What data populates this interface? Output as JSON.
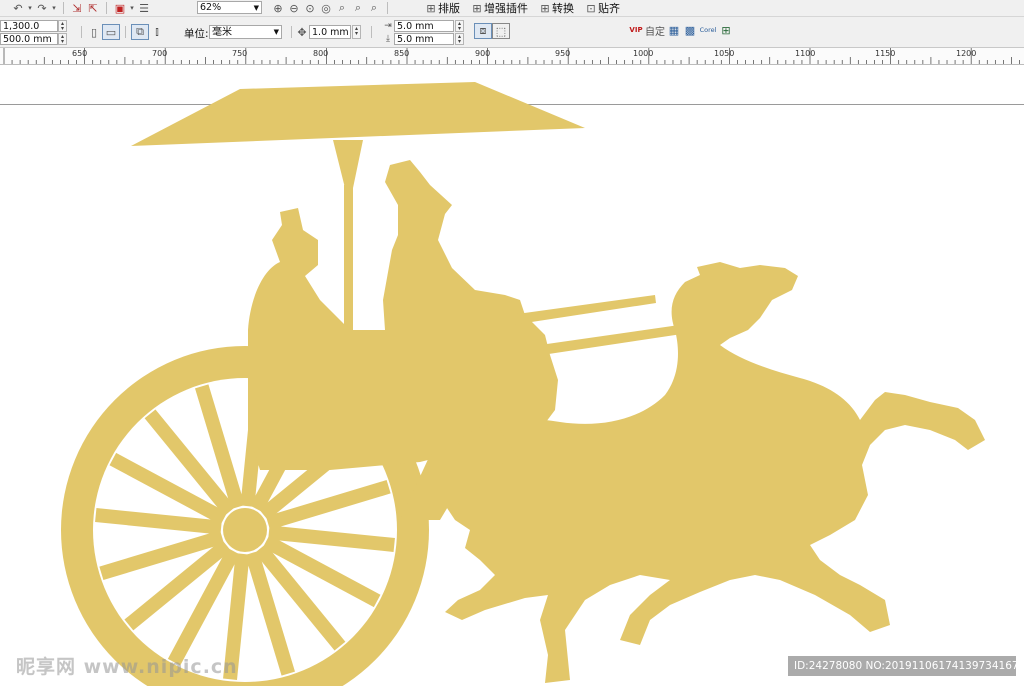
{
  "toolbar_top": {
    "zoom": "62%",
    "menus": [
      {
        "label": "排版",
        "icon": "layout-icon"
      },
      {
        "label": "增强插件",
        "icon": "plugin-icon"
      },
      {
        "label": "转换",
        "icon": "convert-icon"
      },
      {
        "label": "贴齐",
        "icon": "snap-icon"
      }
    ]
  },
  "property_bar": {
    "width": "1,300.0 mm",
    "height": "500.0 mm",
    "units_label": "单位:",
    "units_value": "毫米",
    "nudge": "1.0 mm",
    "dup_x": "5.0 mm",
    "dup_y": "5.0 mm"
  },
  "plugins": {
    "vip": "VIP",
    "custom": "自定",
    "corel": "Corel"
  },
  "ruler": {
    "labels": [
      "650",
      "700",
      "750",
      "800",
      "850",
      "900",
      "950",
      "1000",
      "1050",
      "1100",
      "1150",
      "1200"
    ]
  },
  "artwork": {
    "fill": "#e2c76a"
  },
  "watermark": {
    "site": "昵享网 www.nipic.cn",
    "id": "ID:24278080 NO:20191106174139734167"
  }
}
